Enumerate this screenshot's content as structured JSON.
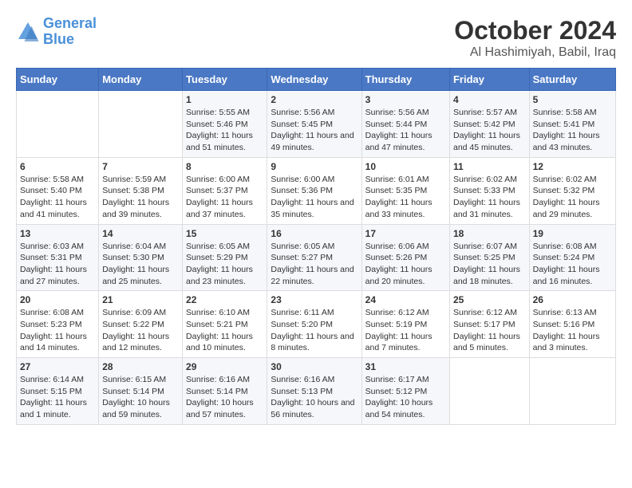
{
  "logo": {
    "line1": "General",
    "line2": "Blue"
  },
  "title": "October 2024",
  "location": "Al Hashimiyah, Babil, Iraq",
  "days_of_week": [
    "Sunday",
    "Monday",
    "Tuesday",
    "Wednesday",
    "Thursday",
    "Friday",
    "Saturday"
  ],
  "weeks": [
    [
      {
        "day": "",
        "info": ""
      },
      {
        "day": "",
        "info": ""
      },
      {
        "day": "1",
        "info": "Sunrise: 5:55 AM\nSunset: 5:46 PM\nDaylight: 11 hours and 51 minutes."
      },
      {
        "day": "2",
        "info": "Sunrise: 5:56 AM\nSunset: 5:45 PM\nDaylight: 11 hours and 49 minutes."
      },
      {
        "day": "3",
        "info": "Sunrise: 5:56 AM\nSunset: 5:44 PM\nDaylight: 11 hours and 47 minutes."
      },
      {
        "day": "4",
        "info": "Sunrise: 5:57 AM\nSunset: 5:42 PM\nDaylight: 11 hours and 45 minutes."
      },
      {
        "day": "5",
        "info": "Sunrise: 5:58 AM\nSunset: 5:41 PM\nDaylight: 11 hours and 43 minutes."
      }
    ],
    [
      {
        "day": "6",
        "info": "Sunrise: 5:58 AM\nSunset: 5:40 PM\nDaylight: 11 hours and 41 minutes."
      },
      {
        "day": "7",
        "info": "Sunrise: 5:59 AM\nSunset: 5:38 PM\nDaylight: 11 hours and 39 minutes."
      },
      {
        "day": "8",
        "info": "Sunrise: 6:00 AM\nSunset: 5:37 PM\nDaylight: 11 hours and 37 minutes."
      },
      {
        "day": "9",
        "info": "Sunrise: 6:00 AM\nSunset: 5:36 PM\nDaylight: 11 hours and 35 minutes."
      },
      {
        "day": "10",
        "info": "Sunrise: 6:01 AM\nSunset: 5:35 PM\nDaylight: 11 hours and 33 minutes."
      },
      {
        "day": "11",
        "info": "Sunrise: 6:02 AM\nSunset: 5:33 PM\nDaylight: 11 hours and 31 minutes."
      },
      {
        "day": "12",
        "info": "Sunrise: 6:02 AM\nSunset: 5:32 PM\nDaylight: 11 hours and 29 minutes."
      }
    ],
    [
      {
        "day": "13",
        "info": "Sunrise: 6:03 AM\nSunset: 5:31 PM\nDaylight: 11 hours and 27 minutes."
      },
      {
        "day": "14",
        "info": "Sunrise: 6:04 AM\nSunset: 5:30 PM\nDaylight: 11 hours and 25 minutes."
      },
      {
        "day": "15",
        "info": "Sunrise: 6:05 AM\nSunset: 5:29 PM\nDaylight: 11 hours and 23 minutes."
      },
      {
        "day": "16",
        "info": "Sunrise: 6:05 AM\nSunset: 5:27 PM\nDaylight: 11 hours and 22 minutes."
      },
      {
        "day": "17",
        "info": "Sunrise: 6:06 AM\nSunset: 5:26 PM\nDaylight: 11 hours and 20 minutes."
      },
      {
        "day": "18",
        "info": "Sunrise: 6:07 AM\nSunset: 5:25 PM\nDaylight: 11 hours and 18 minutes."
      },
      {
        "day": "19",
        "info": "Sunrise: 6:08 AM\nSunset: 5:24 PM\nDaylight: 11 hours and 16 minutes."
      }
    ],
    [
      {
        "day": "20",
        "info": "Sunrise: 6:08 AM\nSunset: 5:23 PM\nDaylight: 11 hours and 14 minutes."
      },
      {
        "day": "21",
        "info": "Sunrise: 6:09 AM\nSunset: 5:22 PM\nDaylight: 11 hours and 12 minutes."
      },
      {
        "day": "22",
        "info": "Sunrise: 6:10 AM\nSunset: 5:21 PM\nDaylight: 11 hours and 10 minutes."
      },
      {
        "day": "23",
        "info": "Sunrise: 6:11 AM\nSunset: 5:20 PM\nDaylight: 11 hours and 8 minutes."
      },
      {
        "day": "24",
        "info": "Sunrise: 6:12 AM\nSunset: 5:19 PM\nDaylight: 11 hours and 7 minutes."
      },
      {
        "day": "25",
        "info": "Sunrise: 6:12 AM\nSunset: 5:17 PM\nDaylight: 11 hours and 5 minutes."
      },
      {
        "day": "26",
        "info": "Sunrise: 6:13 AM\nSunset: 5:16 PM\nDaylight: 11 hours and 3 minutes."
      }
    ],
    [
      {
        "day": "27",
        "info": "Sunrise: 6:14 AM\nSunset: 5:15 PM\nDaylight: 11 hours and 1 minute."
      },
      {
        "day": "28",
        "info": "Sunrise: 6:15 AM\nSunset: 5:14 PM\nDaylight: 10 hours and 59 minutes."
      },
      {
        "day": "29",
        "info": "Sunrise: 6:16 AM\nSunset: 5:14 PM\nDaylight: 10 hours and 57 minutes."
      },
      {
        "day": "30",
        "info": "Sunrise: 6:16 AM\nSunset: 5:13 PM\nDaylight: 10 hours and 56 minutes."
      },
      {
        "day": "31",
        "info": "Sunrise: 6:17 AM\nSunset: 5:12 PM\nDaylight: 10 hours and 54 minutes."
      },
      {
        "day": "",
        "info": ""
      },
      {
        "day": "",
        "info": ""
      }
    ]
  ]
}
